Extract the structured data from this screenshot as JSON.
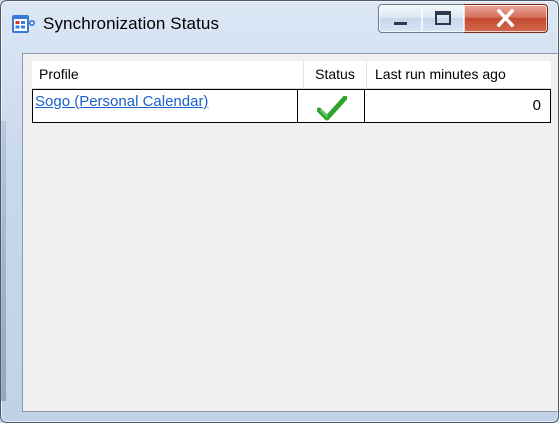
{
  "window": {
    "title": "Synchronization Status",
    "icon": "calendar-sync-icon",
    "controls": {
      "minimize": "minimize-icon",
      "maximize": "maximize-icon",
      "close": "close-icon"
    }
  },
  "table": {
    "columns": [
      "Profile",
      "Status",
      "Last run minutes ago"
    ],
    "rows": [
      {
        "profile": "Sogo (Personal Calendar)",
        "status_icon": "check-icon",
        "last_run_minutes_ago": "0"
      }
    ]
  },
  "colors": {
    "link": "#1a5fcc",
    "check": "#2fa52f",
    "close_button": "#c24a30"
  }
}
